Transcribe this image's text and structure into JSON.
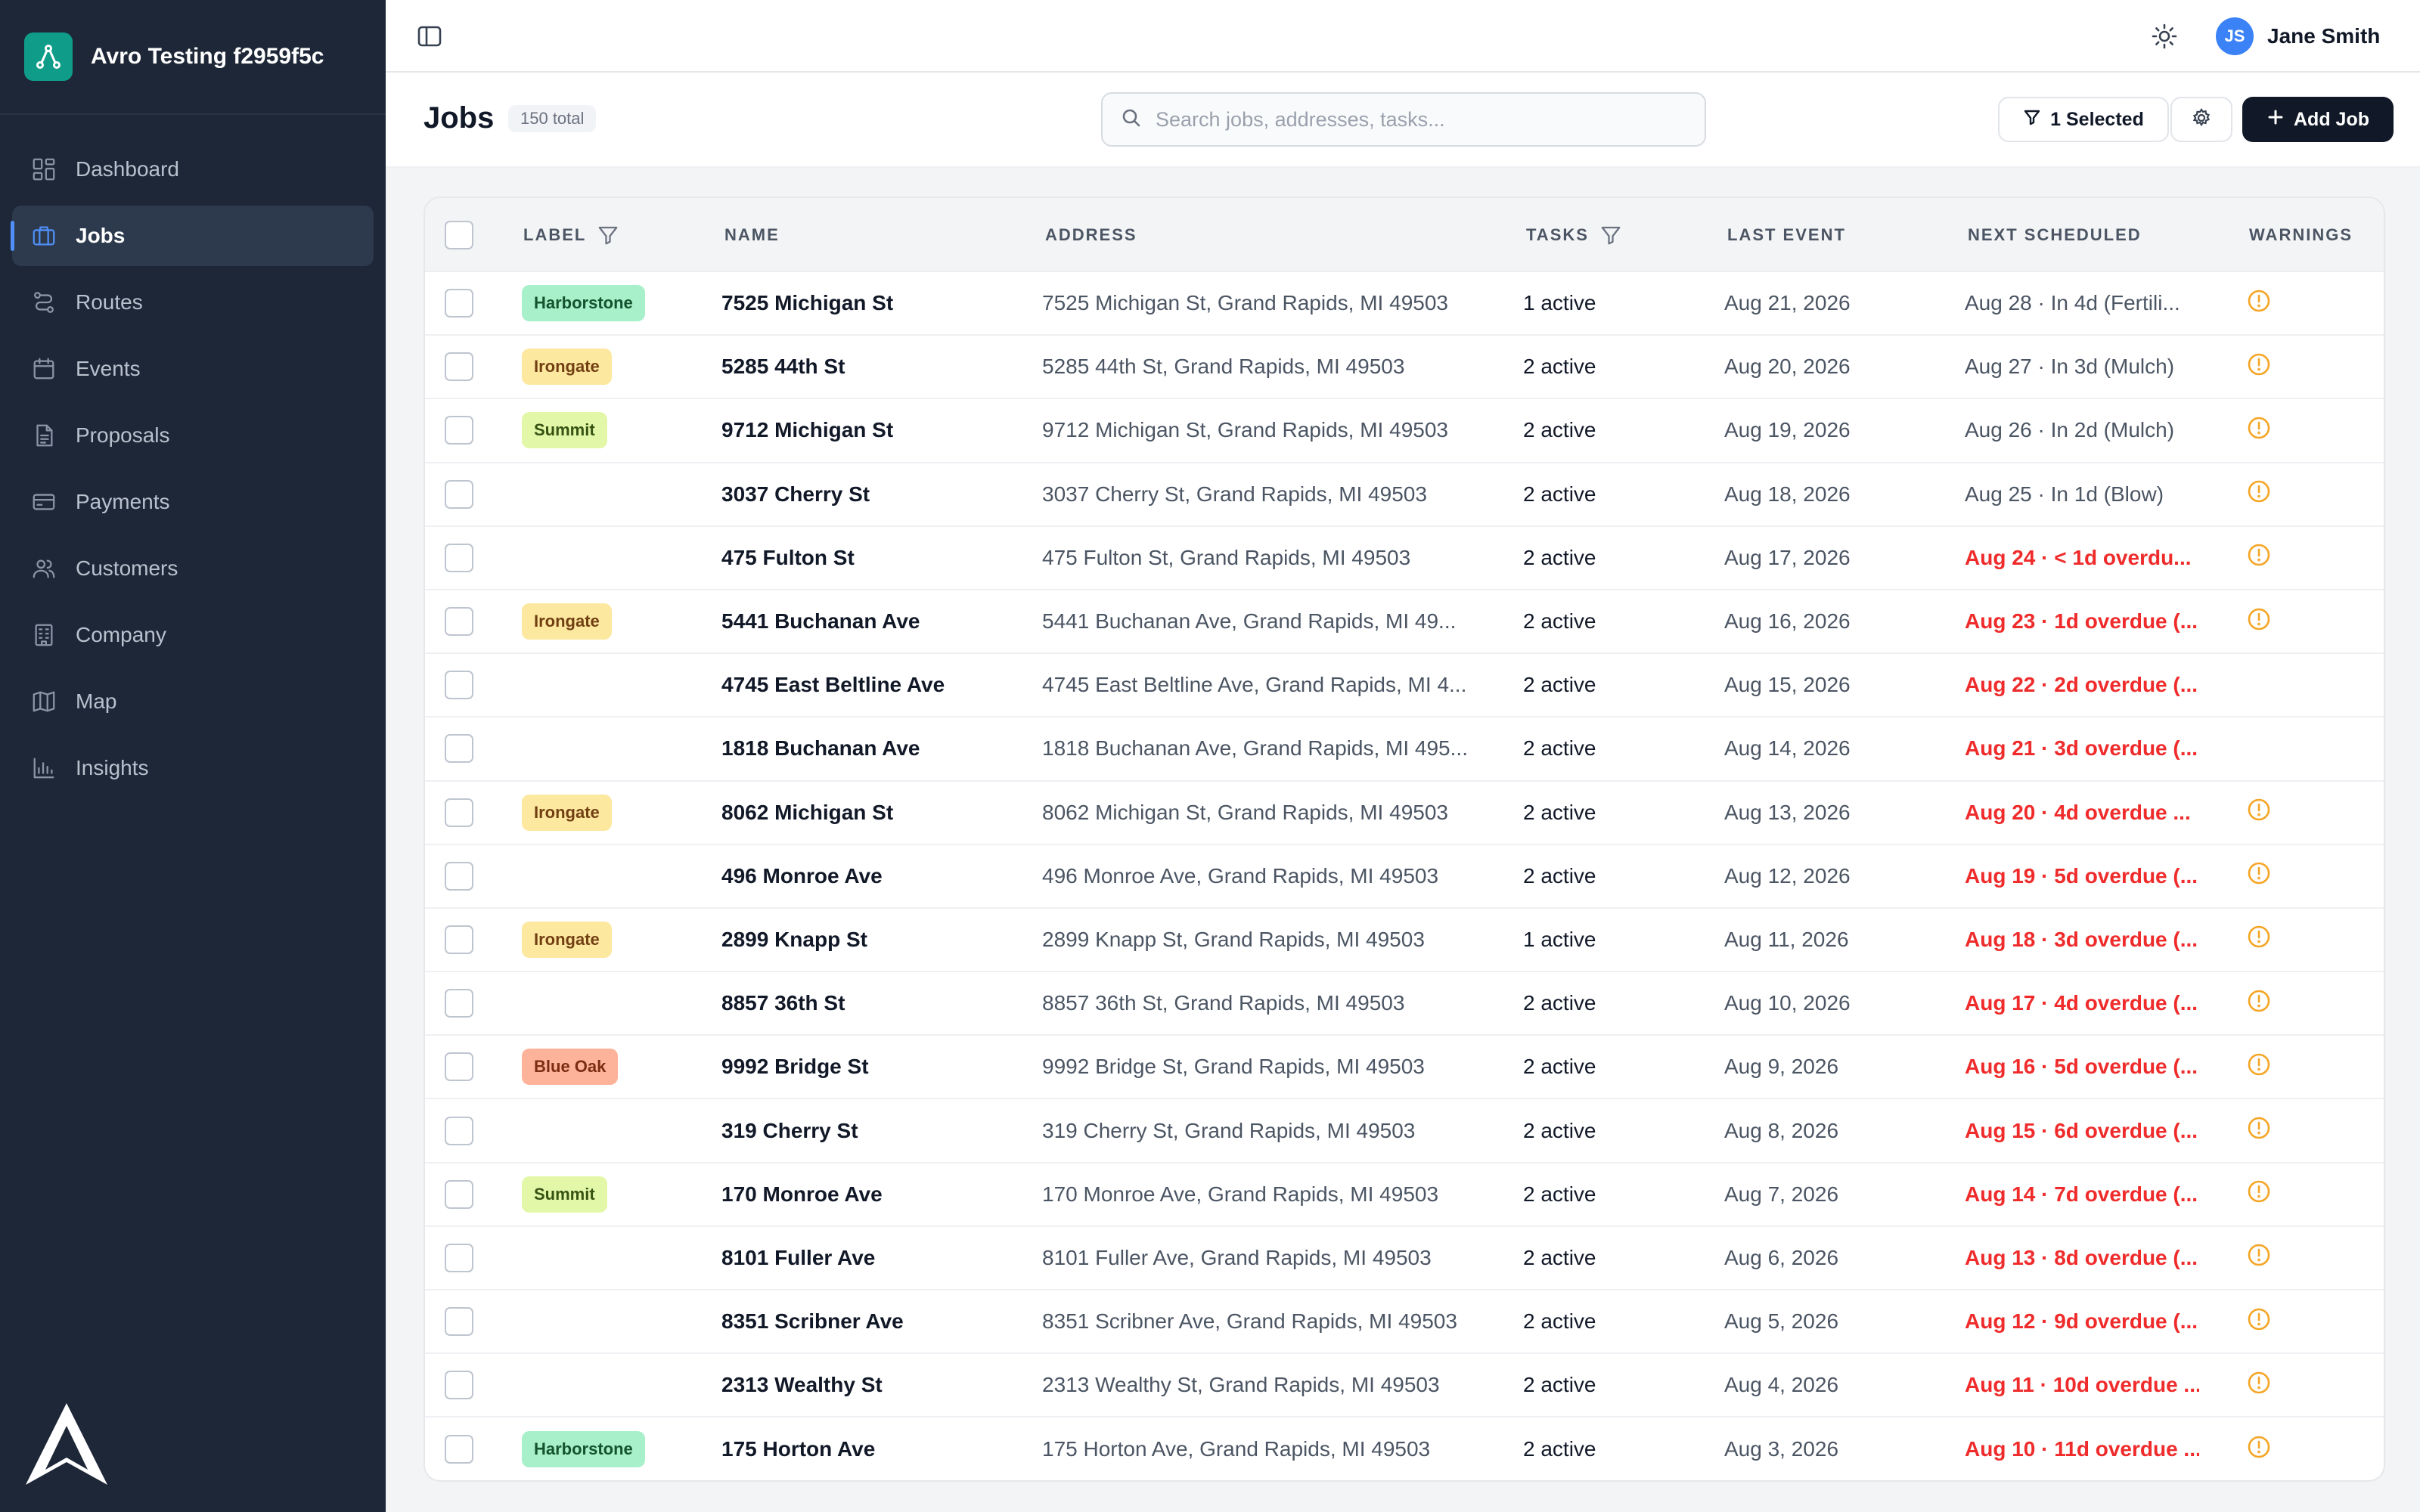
{
  "app": {
    "workspace_name": "Avro Testing f2959f5c"
  },
  "sidebar": {
    "items": [
      {
        "label": "Dashboard",
        "icon": "dashboard-icon"
      },
      {
        "label": "Jobs",
        "icon": "briefcase-icon",
        "active": true
      },
      {
        "label": "Routes",
        "icon": "route-icon"
      },
      {
        "label": "Events",
        "icon": "calendar-icon"
      },
      {
        "label": "Proposals",
        "icon": "document-icon"
      },
      {
        "label": "Payments",
        "icon": "credit-card-icon"
      },
      {
        "label": "Customers",
        "icon": "users-icon"
      },
      {
        "label": "Company",
        "icon": "building-icon"
      },
      {
        "label": "Map",
        "icon": "map-icon"
      },
      {
        "label": "Insights",
        "icon": "bar-chart-icon"
      }
    ]
  },
  "topbar": {
    "user_initials": "JS",
    "user_name": "Jane Smith"
  },
  "header": {
    "title": "Jobs",
    "total": "150 total",
    "search_placeholder": "Search jobs, addresses, tasks...",
    "selected_label": "1 Selected",
    "add_label": "Add Job"
  },
  "table": {
    "columns": {
      "label": "LABEL",
      "name": "NAME",
      "address": "ADDRESS",
      "tasks": "TASKS",
      "last_event": "LAST EVENT",
      "next_scheduled": "NEXT SCHEDULED",
      "warnings": "WARNINGS"
    },
    "rows": [
      {
        "label": "Harborstone",
        "name": "7525 Michigan St",
        "address": "7525 Michigan St, Grand Rapids, MI 49503",
        "tasks": "1 active",
        "last": "Aug 21, 2026",
        "next": "Aug 28 · In 4d (Fertili...",
        "overdue": false,
        "warning": true
      },
      {
        "label": "Irongate",
        "name": "5285 44th St",
        "address": "5285 44th St, Grand Rapids, MI 49503",
        "tasks": "2 active",
        "last": "Aug 20, 2026",
        "next": "Aug 27 · In 3d (Mulch)",
        "overdue": false,
        "warning": true
      },
      {
        "label": "Summit",
        "name": "9712 Michigan St",
        "address": "9712 Michigan St, Grand Rapids, MI 49503",
        "tasks": "2 active",
        "last": "Aug 19, 2026",
        "next": "Aug 26 · In 2d (Mulch)",
        "overdue": false,
        "warning": true
      },
      {
        "label": "",
        "name": "3037 Cherry St",
        "address": "3037 Cherry St, Grand Rapids, MI 49503",
        "tasks": "2 active",
        "last": "Aug 18, 2026",
        "next": "Aug 25 · In 1d (Blow)",
        "overdue": false,
        "warning": true
      },
      {
        "label": "",
        "name": "475 Fulton St",
        "address": "475 Fulton St, Grand Rapids, MI 49503",
        "tasks": "2 active",
        "last": "Aug 17, 2026",
        "next": "Aug 24 · < 1d overdu...",
        "overdue": true,
        "warning": true
      },
      {
        "label": "Irongate",
        "name": "5441 Buchanan Ave",
        "address": "5441 Buchanan Ave, Grand Rapids, MI 49...",
        "tasks": "2 active",
        "last": "Aug 16, 2026",
        "next": "Aug 23 · 1d overdue (...",
        "overdue": true,
        "warning": true
      },
      {
        "label": "",
        "name": "4745 East Beltline Ave",
        "address": "4745 East Beltline Ave, Grand Rapids, MI 4...",
        "tasks": "2 active",
        "last": "Aug 15, 2026",
        "next": "Aug 22 · 2d overdue (...",
        "overdue": true,
        "warning": false
      },
      {
        "label": "",
        "name": "1818 Buchanan Ave",
        "address": "1818 Buchanan Ave, Grand Rapids, MI 495...",
        "tasks": "2 active",
        "last": "Aug 14, 2026",
        "next": "Aug 21 · 3d overdue (...",
        "overdue": true,
        "warning": false
      },
      {
        "label": "Irongate",
        "name": "8062 Michigan St",
        "address": "8062 Michigan St, Grand Rapids, MI 49503",
        "tasks": "2 active",
        "last": "Aug 13, 2026",
        "next": "Aug 20 · 4d overdue ...",
        "overdue": true,
        "warning": true
      },
      {
        "label": "",
        "name": "496 Monroe Ave",
        "address": "496 Monroe Ave, Grand Rapids, MI 49503",
        "tasks": "2 active",
        "last": "Aug 12, 2026",
        "next": "Aug 19 · 5d overdue (...",
        "overdue": true,
        "warning": true
      },
      {
        "label": "Irongate",
        "name": "2899 Knapp St",
        "address": "2899 Knapp St, Grand Rapids, MI 49503",
        "tasks": "1 active",
        "last": "Aug 11, 2026",
        "next": "Aug 18 · 3d overdue (...",
        "overdue": true,
        "warning": true
      },
      {
        "label": "",
        "name": "8857 36th St",
        "address": "8857 36th St, Grand Rapids, MI 49503",
        "tasks": "2 active",
        "last": "Aug 10, 2026",
        "next": "Aug 17 · 4d overdue (...",
        "overdue": true,
        "warning": true
      },
      {
        "label": "Blue Oak",
        "name": "9992 Bridge St",
        "address": "9992 Bridge St, Grand Rapids, MI 49503",
        "tasks": "2 active",
        "last": "Aug 9, 2026",
        "next": "Aug 16 · 5d overdue (...",
        "overdue": true,
        "warning": true
      },
      {
        "label": "",
        "name": "319 Cherry St",
        "address": "319 Cherry St, Grand Rapids, MI 49503",
        "tasks": "2 active",
        "last": "Aug 8, 2026",
        "next": "Aug 15 · 6d overdue (...",
        "overdue": true,
        "warning": true
      },
      {
        "label": "Summit",
        "name": "170 Monroe Ave",
        "address": "170 Monroe Ave, Grand Rapids, MI 49503",
        "tasks": "2 active",
        "last": "Aug 7, 2026",
        "next": "Aug 14 · 7d overdue (...",
        "overdue": true,
        "warning": true
      },
      {
        "label": "",
        "name": "8101 Fuller Ave",
        "address": "8101 Fuller Ave, Grand Rapids, MI 49503",
        "tasks": "2 active",
        "last": "Aug 6, 2026",
        "next": "Aug 13 · 8d overdue (...",
        "overdue": true,
        "warning": true
      },
      {
        "label": "",
        "name": "8351 Scribner Ave",
        "address": "8351 Scribner Ave, Grand Rapids, MI 49503",
        "tasks": "2 active",
        "last": "Aug 5, 2026",
        "next": "Aug 12 · 9d overdue (...",
        "overdue": true,
        "warning": true
      },
      {
        "label": "",
        "name": "2313 Wealthy St",
        "address": "2313 Wealthy St, Grand Rapids, MI 49503",
        "tasks": "2 active",
        "last": "Aug 4, 2026",
        "next": "Aug 11 · 10d overdue ...",
        "overdue": true,
        "warning": true
      },
      {
        "label": "Harborstone",
        "name": "175 Horton Ave",
        "address": "175 Horton Ave, Grand Rapids, MI 49503",
        "tasks": "2 active",
        "last": "Aug 3, 2026",
        "next": "Aug 10 · 11d overdue ...",
        "overdue": true,
        "warning": true
      }
    ]
  },
  "label_colors": {
    "Harborstone": {
      "bg": "#a7f0c9",
      "fg": "#14532d"
    },
    "Irongate": {
      "bg": "#fde8a0",
      "fg": "#713f12"
    },
    "Summit": {
      "bg": "#e2f8a8",
      "fg": "#365314"
    },
    "Blue Oak": {
      "bg": "#fdb39a",
      "fg": "#7c2d12"
    }
  },
  "colors": {
    "sidebar_bg": "#1e2737",
    "brand_accent": "#0f9d8a",
    "overdue_red": "#ef2b2b",
    "warning_amber": "#f5a524",
    "primary_button": "#111827"
  }
}
